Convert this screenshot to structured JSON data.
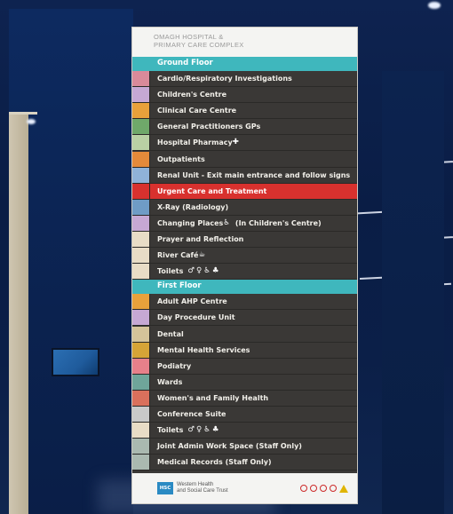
{
  "sign": {
    "header_line1": "OMAGH HOSPITAL &",
    "header_line2": "PRIMARY CARE COMPLEX",
    "ground_floor": "Ground Floor",
    "first_floor": "First Floor",
    "ground_rows": [
      {
        "label": "Cardio/Respiratory Investigations",
        "color": "#d98a9a"
      },
      {
        "label": "Children's Centre",
        "color": "#c6a8d4"
      },
      {
        "label": "Clinical Care Centre",
        "color": "#e8a13b"
      },
      {
        "label": "General Practitioners GPs",
        "color": "#6fa86a"
      },
      {
        "label": "Hospital Pharmacy",
        "color": "#b9d0a4"
      },
      {
        "label": "Outpatients",
        "color": "#e48a3a"
      },
      {
        "label": "Renal Unit - Exit main entrance and follow signs",
        "color": "#8fb2d8"
      },
      {
        "label": "Urgent Care and Treatment",
        "color": "#d8312e"
      },
      {
        "label": "X-Ray (Radiology)",
        "color": "#6f9cc6"
      },
      {
        "label": "Changing Places",
        "color": "#c6a8d4"
      },
      {
        "label": "Prayer and Reflection",
        "color": "#e8dcc6"
      },
      {
        "label": "River Café",
        "color": "#e8dcc6"
      },
      {
        "label": "Toilets",
        "color": "#e8dcc6"
      }
    ],
    "changing_places_note": "(In Children's Centre)",
    "first_rows": [
      {
        "label": "Adult AHP Centre",
        "color": "#e8a13b"
      },
      {
        "label": "Day Procedure Unit",
        "color": "#c6a8d4"
      },
      {
        "label": "Dental",
        "color": "#d4c39a"
      },
      {
        "label": "Mental Health Services",
        "color": "#d6a437"
      },
      {
        "label": "Podiatry",
        "color": "#e6808a"
      },
      {
        "label": "Wards",
        "color": "#6fa59a"
      },
      {
        "label": "Women's and Family Health",
        "color": "#d9705c"
      },
      {
        "label": "Conference Suite",
        "color": "#c9c9c9"
      },
      {
        "label": "Toilets",
        "color": "#e8dcc6"
      },
      {
        "label": "Joint Admin Work Space (Staff Only)",
        "color": "#aab9b0"
      },
      {
        "label": "Medical Records (Staff Only)",
        "color": "#aab9b0"
      }
    ],
    "footer_logo": "HSC",
    "footer_trust_line1": "Western Health",
    "footer_trust_line2": "and Social Care Trust"
  }
}
